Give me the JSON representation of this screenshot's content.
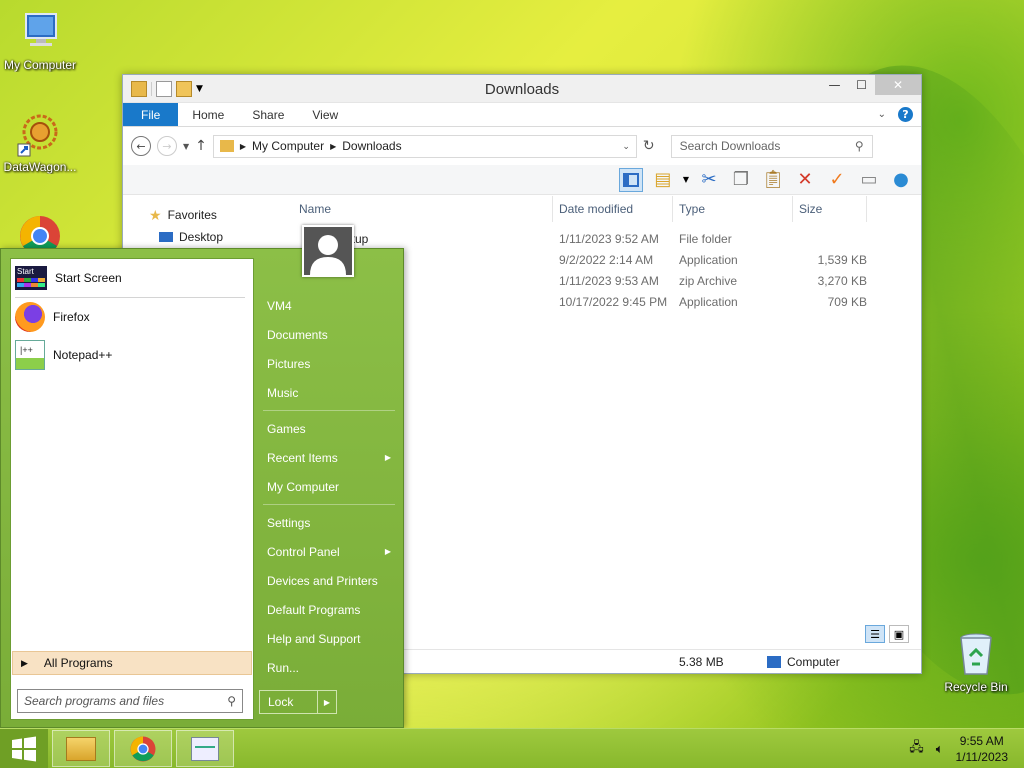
{
  "desktop": {
    "icons": [
      {
        "label": "My Computer"
      },
      {
        "label": "DataWagon..."
      },
      {
        "label": "Recycle Bin"
      }
    ]
  },
  "explorer": {
    "title": "Downloads",
    "tabs": [
      "File",
      "Home",
      "Share",
      "View"
    ],
    "breadcrumb": [
      "My Computer",
      "Downloads"
    ],
    "search_placeholder": "Search Downloads",
    "nav": {
      "favorites": "Favorites",
      "desktop": "Desktop"
    },
    "columns": {
      "name": "Name",
      "date": "Date modified",
      "type": "Type",
      "size": "Size"
    },
    "files": [
      {
        "name": "etup",
        "date": "1/11/2023 9:52 AM",
        "type": "File folder",
        "size": ""
      },
      {
        "name": "",
        "date": "9/2/2022 2:14 AM",
        "type": "Application",
        "size": "1,539 KB"
      },
      {
        "name": "",
        "date": "1/11/2023 9:53 AM",
        "type": "zip Archive",
        "size": "3,270 KB"
      },
      {
        "name": "",
        "date": "10/17/2022 9:45 PM",
        "type": "Application",
        "size": "709 KB"
      }
    ],
    "status": {
      "size": "5.38 MB",
      "location": "Computer"
    }
  },
  "start_menu": {
    "pinned": [
      {
        "label": "Start Screen",
        "icon": "start-screen-icon"
      },
      {
        "label": "Firefox",
        "icon": "firefox-icon"
      },
      {
        "label": "Notepad++",
        "icon": "notepadpp-icon"
      }
    ],
    "all_programs": "All Programs",
    "search_placeholder": "Search programs and files",
    "right_links": {
      "vm4": "VM4",
      "documents": "Documents",
      "pictures": "Pictures",
      "music": "Music",
      "games": "Games",
      "recent_items": "Recent Items",
      "my_computer": "My Computer",
      "settings": "Settings",
      "control_panel": "Control Panel",
      "devices": "Devices and Printers",
      "default_programs": "Default Programs",
      "help": "Help and Support",
      "run": "Run..."
    },
    "lock_label": "Lock"
  },
  "taskbar": {
    "time": "9:55 AM",
    "date": "1/11/2023"
  },
  "colors": {
    "accent": "#1979ca",
    "start_menu_green": "#8cbf47",
    "taskbar_green": "#9ec93e"
  }
}
